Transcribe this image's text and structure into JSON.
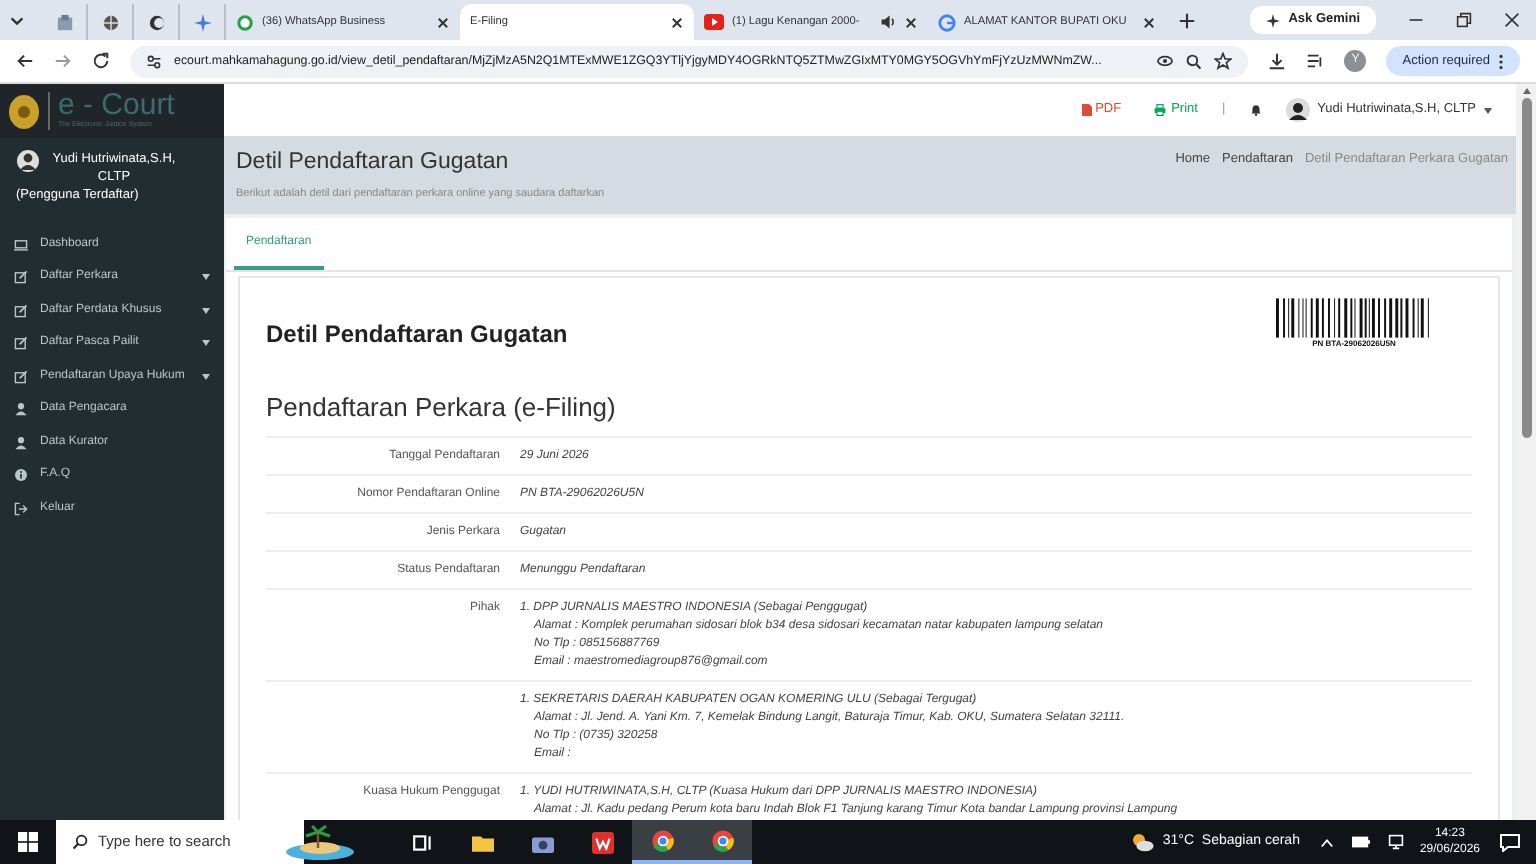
{
  "browser": {
    "tabs": [
      {
        "kind": "pinned",
        "selected": false
      },
      {
        "kind": "pinned",
        "selected": false
      },
      {
        "kind": "pinned",
        "selected": false
      },
      {
        "kind": "pinned",
        "selected": false
      },
      {
        "kind": "whatsapp",
        "title": "(36) WhatsApp Business",
        "selected": false
      },
      {
        "kind": "plain",
        "title": "E-Filing",
        "selected": true
      },
      {
        "kind": "youtube",
        "title": "(1) Lagu Kenangan 2000-",
        "selected": false
      },
      {
        "kind": "google",
        "title": "ALAMAT KANTOR BUPATI OKU",
        "selected": false
      }
    ],
    "gemini": "Ask Gemini",
    "url": "ecourt.mahkamahagung.go.id/view_detil_pendaftaran/MjZjMzA5N2Q1MTExMWE1ZGQ3YTljYjgyMDY4OGRkNTQ5ZTMwZGIxMTY0MGY5OGVhYmFjYzUzMWNmZW...",
    "profile_initial": "Y",
    "action": "Action required"
  },
  "app": {
    "logo": {
      "text": "e - Court",
      "tagline": "The Electronic Justice System"
    },
    "user": {
      "name": "Yudi Hutriwinata,S.H, CLTP",
      "role": "(Pengguna Terdaftar)"
    },
    "menu": [
      {
        "kind": "dashboard",
        "label": "Dashboard",
        "expandable": false
      },
      {
        "kind": "form",
        "label": "Daftar Perkara",
        "expandable": true
      },
      {
        "kind": "form",
        "label": "Daftar Perdata Khusus",
        "expandable": true
      },
      {
        "kind": "form",
        "label": "Daftar Pasca Pailit",
        "expandable": true
      },
      {
        "kind": "form",
        "label": "Pendaftaran Upaya Hukum",
        "expandable": true
      },
      {
        "kind": "person",
        "label": "Data Pengacara",
        "expandable": false
      },
      {
        "kind": "person",
        "label": "Data Kurator",
        "expandable": false
      },
      {
        "kind": "help",
        "label": "F.A.Q",
        "expandable": false
      },
      {
        "kind": "exit",
        "label": "Keluar",
        "expandable": false
      }
    ],
    "topbar": {
      "pdf": "PDF",
      "print": "Print",
      "separator": "|",
      "user": "Yudi Hutriwinata,S.H, CLTP"
    },
    "page_header": {
      "title": "Detil Pendaftaran Gugatan",
      "subtitle": "Berikut adalah detil dari pendaftaran perkara online yang saudara daftarkan",
      "breadcrumb": [
        {
          "label": "Home",
          "current": false
        },
        {
          "label": "Pendaftaran",
          "current": false
        },
        {
          "label": "Detil Pendaftaran Perkara Gugatan",
          "current": true
        }
      ]
    },
    "tabs": [
      {
        "label": "Pendaftaran",
        "selected": true
      }
    ],
    "heading": "Detil Pendaftaran Gugatan",
    "barcode_text": "PN BTA-29062026U5N",
    "section_title": "Pendaftaran Perkara (e-Filing)",
    "rows": [
      {
        "label": "Tanggal Pendaftaran",
        "entries": [
          {
            "title": "29 Juni 2026"
          }
        ]
      },
      {
        "label": "Nomor Pendaftaran Online",
        "entries": [
          {
            "title": "PN BTA-29062026U5N"
          }
        ]
      },
      {
        "label": "Jenis Perkara",
        "entries": [
          {
            "title": "Gugatan"
          }
        ]
      },
      {
        "label": "Status Pendaftaran",
        "entries": [
          {
            "title": "Menunggu Pendaftaran"
          }
        ]
      },
      {
        "label": "Pihak",
        "entries": [
          {
            "title": "1. DPP JURNALIS MAESTRO INDONESIA (Sebagai Penggugat)",
            "details": [
              "Alamat : Komplek perumahan sidosari blok b34 desa sidosari kecamatan natar kabupaten lampung selatan",
              "No Tlp : 085156887769",
              "Email : maestromediagroup876@gmail.com"
            ]
          }
        ]
      },
      {
        "label": "",
        "entries": [
          {
            "title": "1. SEKRETARIS DAERAH KABUPATEN OGAN KOMERING ULU (Sebagai Tergugat)",
            "details": [
              "Alamat : Jl. Jend. A. Yani Km. 7, Kemelak Bindung Langit, Baturaja Timur, Kab. OKU, Sumatera Selatan 32111.",
              "No Tlp : (0735) 320258",
              "Email :"
            ]
          }
        ]
      },
      {
        "label": "Kuasa Hukum Penggugat",
        "entries": [
          {
            "title": "1. YUDI HUTRIWINATA,S.H, CLTP (Kuasa Hukum dari DPP JURNALIS MAESTRO INDONESIA)",
            "details": [
              "Alamat : Jl. Kadu pedang Perum kota baru Indah Blok F1 Tanjung karang Timur Kota bandar Lampung provinsi Lampung"
            ]
          }
        ]
      }
    ]
  },
  "taskbar": {
    "search": "Type here to search",
    "weather": "31°C  Sebagian cerah",
    "time": "14:23",
    "date": "29/06/2026"
  }
}
